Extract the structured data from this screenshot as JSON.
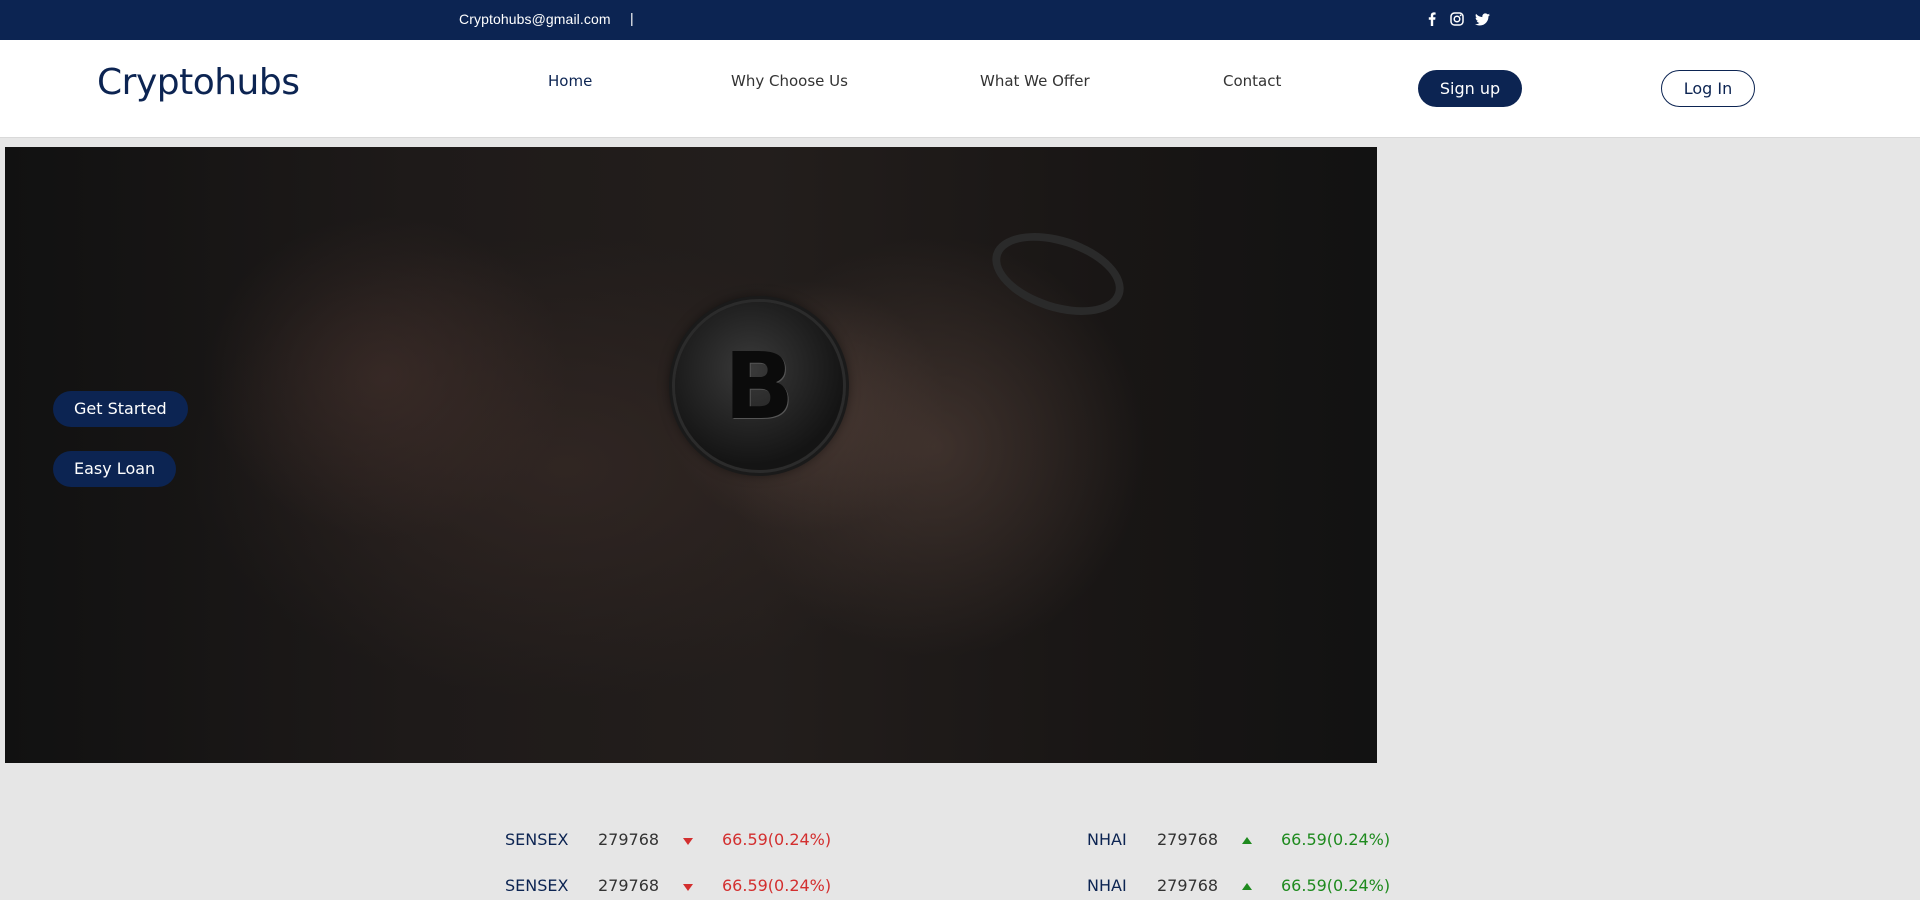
{
  "topbar": {
    "email": "Cryptohubs@gmail.com",
    "separator": "|",
    "social_icons": [
      "facebook-icon",
      "instagram-icon",
      "twitter-icon"
    ]
  },
  "header": {
    "logo": "Cryptohubs",
    "nav": [
      {
        "label": "Home",
        "active": true
      },
      {
        "label": "Why Choose Us",
        "active": false
      },
      {
        "label": "What We Offer",
        "active": false
      },
      {
        "label": "Contact",
        "active": false
      }
    ],
    "signup_label": "Sign up",
    "login_label": "Log In"
  },
  "hero": {
    "get_started_label": "Get Started",
    "easy_loan_label": "Easy Loan",
    "coin_symbol": "B"
  },
  "ticker": [
    {
      "name": "SENSEX",
      "value": "279768",
      "direction": "down",
      "change": "66.59(0.24%)"
    },
    {
      "name": "NHAI",
      "value": "279768",
      "direction": "up",
      "change": "66.59(0.24%)"
    },
    {
      "name": "SENSEX",
      "value": "279768",
      "direction": "down",
      "change": "66.59(0.24%)"
    },
    {
      "name": "NHAI",
      "value": "279768",
      "direction": "up",
      "change": "66.59(0.24%)"
    }
  ],
  "colors": {
    "brand": "#0c2452",
    "down": "#d32f2f",
    "up": "#1e8a1e",
    "page_bg": "#e6e6e6"
  }
}
